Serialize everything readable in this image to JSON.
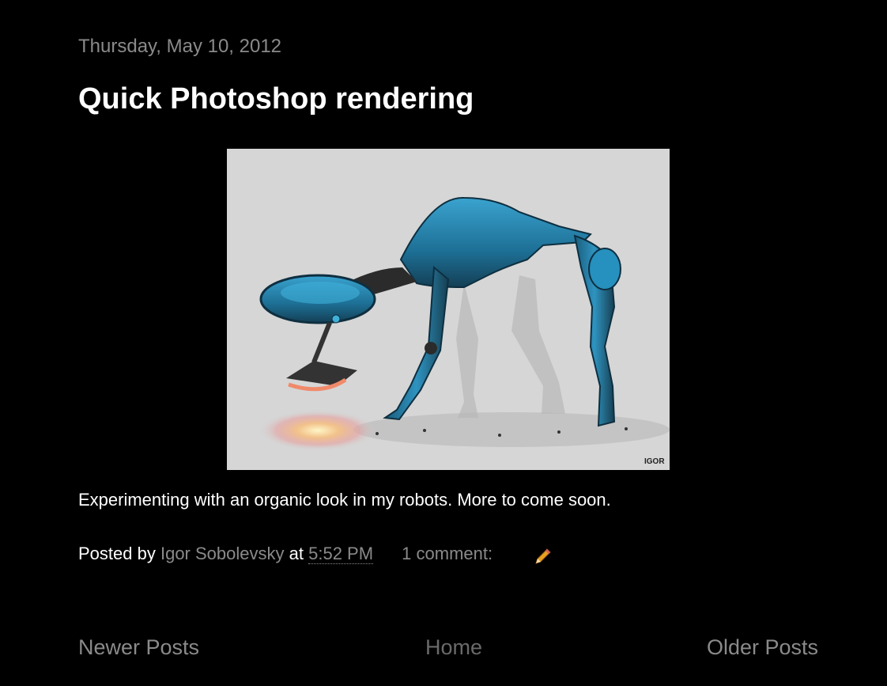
{
  "post": {
    "date": "Thursday, May 10, 2012",
    "title": "Quick Photoshop rendering",
    "body": "Experimenting with an organic look in my robots. More to come soon.",
    "image_signature": "IGOR"
  },
  "footer": {
    "posted_by_label": "Posted by",
    "author": "Igor Sobolevsky",
    "at_label": "at",
    "time": "5:52 PM",
    "comments": "1 comment:",
    "edit_icon": "pencil-icon"
  },
  "pager": {
    "newer": "Newer Posts",
    "home": "Home",
    "older": "Older Posts"
  },
  "colors": {
    "background": "#000000",
    "text": "#ffffff",
    "muted": "#8a8a8a",
    "robot_blue": "#1f7ea8"
  }
}
